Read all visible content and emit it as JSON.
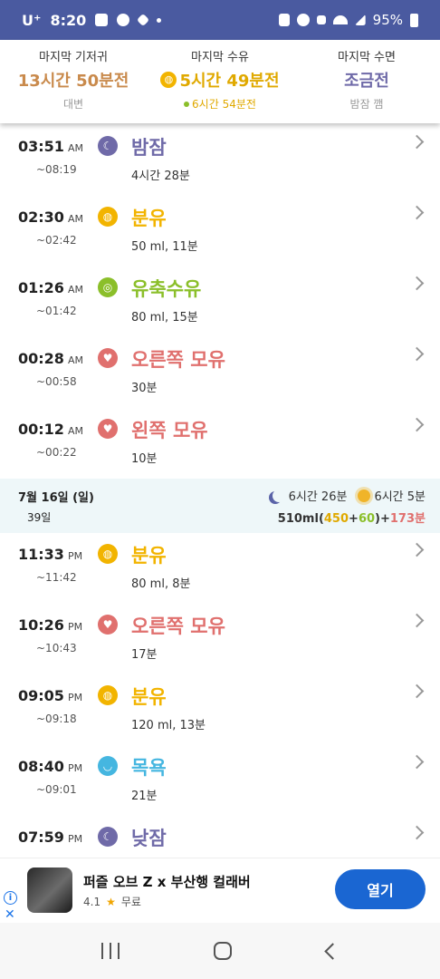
{
  "colors": {
    "diaper": "#c98a4c",
    "formula": "#f2b400",
    "pumped": "#8bbf2a",
    "breast": "#e0706e",
    "sleep": "#6f6aa8",
    "bath": "#45b6e0",
    "purple_bar": "#4a5aa0",
    "day_total_formula": "#e0a900",
    "day_total_pumped": "#8bbf2a",
    "day_total_breast": "#e0706e"
  },
  "status_bar": {
    "carrier": "U⁺",
    "time": "8:20",
    "battery": "95%"
  },
  "summary": [
    {
      "label": "마지막 기저귀",
      "value": "13시간 50분전",
      "sub": "대변",
      "color": "#c98a4c",
      "value_icon": "",
      "sub_icon": false
    },
    {
      "label": "마지막 수유",
      "value": "5시간 49분전",
      "sub": "6시간 54분전",
      "color": "#f2b400",
      "value_icon": "bottle-icon",
      "sub_icon": true
    },
    {
      "label": "마지막 수면",
      "value": "조금전",
      "sub": "밤잠 깸",
      "color": "#6f6aa8",
      "value_icon": "",
      "sub_icon": false
    }
  ],
  "today_entries": [
    {
      "time": "03:51",
      "ampm": "AM",
      "end": "~08:19",
      "icon": "sleep-icon",
      "icon_glyph": "☾",
      "color": "#6f6aa8",
      "title": "밤잠",
      "detail": "4시간 28분",
      "title_color": "#6f6aa8"
    },
    {
      "time": "02:30",
      "ampm": "AM",
      "end": "~02:42",
      "icon": "bottle-icon",
      "icon_glyph": "◍",
      "color": "#f2b400",
      "title": "분유",
      "detail": "50 ml, 11분",
      "title_color": "#f2b400"
    },
    {
      "time": "01:26",
      "ampm": "AM",
      "end": "~01:42",
      "icon": "pumped-milk-icon",
      "icon_glyph": "◎",
      "color": "#8bbf2a",
      "title": "유축수유",
      "detail": "80 ml, 15분",
      "title_color": "#8bbf2a"
    },
    {
      "time": "00:28",
      "ampm": "AM",
      "end": "~00:58",
      "icon": "breastfeed-icon",
      "icon_glyph": "♥",
      "color": "#e0706e",
      "title": "오른쪽 모유",
      "detail": "30분",
      "title_color": "#e0706e"
    },
    {
      "time": "00:12",
      "ampm": "AM",
      "end": "~00:22",
      "icon": "breastfeed-icon",
      "icon_glyph": "♥",
      "color": "#e0706e",
      "title": "왼쪽 모유",
      "detail": "10분",
      "title_color": "#e0706e"
    }
  ],
  "day_header": {
    "date": "7월 16일 (일)",
    "age": "39일",
    "night_sleep": "6시간 26분",
    "day_sleep": "6시간 5분",
    "total_prefix": "510ml",
    "total_open": "(",
    "total_formula": "450",
    "total_plus1": "+",
    "total_pumped": "60",
    "total_close": ")",
    "total_plus2": "+",
    "total_breast": "173분"
  },
  "prev_entries": [
    {
      "time": "11:33",
      "ampm": "PM",
      "end": "~11:42",
      "icon": "bottle-icon",
      "icon_glyph": "◍",
      "color": "#f2b400",
      "title": "분유",
      "detail": "80 ml, 8분",
      "title_color": "#f2b400"
    },
    {
      "time": "10:26",
      "ampm": "PM",
      "end": "~10:43",
      "icon": "breastfeed-icon",
      "icon_glyph": "♥",
      "color": "#e0706e",
      "title": "오른쪽 모유",
      "detail": "17분",
      "title_color": "#e0706e"
    },
    {
      "time": "09:05",
      "ampm": "PM",
      "end": "~09:18",
      "icon": "bottle-icon",
      "icon_glyph": "◍",
      "color": "#f2b400",
      "title": "분유",
      "detail": "120 ml, 13분",
      "title_color": "#f2b400"
    },
    {
      "time": "08:40",
      "ampm": "PM",
      "end": "~09:01",
      "icon": "bath-icon",
      "icon_glyph": "◡",
      "color": "#45b6e0",
      "title": "목욕",
      "detail": "21분",
      "title_color": "#45b6e0"
    },
    {
      "time": "07:59",
      "ampm": "PM",
      "end": "",
      "icon": "sleep-icon",
      "icon_glyph": "☾",
      "color": "#6f6aa8",
      "title": "낮잠",
      "detail": "",
      "title_color": "#6f6aa8"
    }
  ],
  "ad": {
    "title": "퍼즐 오브 Z x 부산행 컬래버",
    "rating": "4.1",
    "star": "★",
    "price": "무료",
    "button": "열기",
    "info": "i",
    "close": "✕"
  }
}
